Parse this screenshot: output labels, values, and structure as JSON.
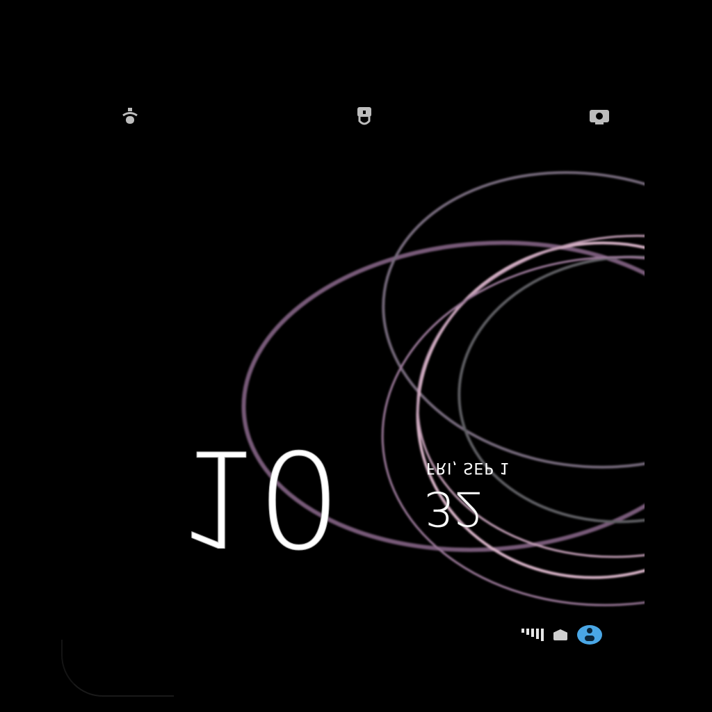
{
  "clock": {
    "hour": "10",
    "minute": "32",
    "date": "FRI, SEP 1"
  },
  "icons": {
    "top_left": "flashlight-icon",
    "top_center": "lock-icon",
    "top_right": "camera-icon",
    "bottom_signal": "signal-bars-icon",
    "bottom_battery": "battery-icon",
    "bottom_app": "app-badge-icon"
  },
  "colors": {
    "background": "#000000",
    "ring_purple": "#8a6a8c",
    "ring_pink": "#d9b8cc",
    "ring_gray": "#6e6e74",
    "accent_blue": "#4aa7e6"
  }
}
